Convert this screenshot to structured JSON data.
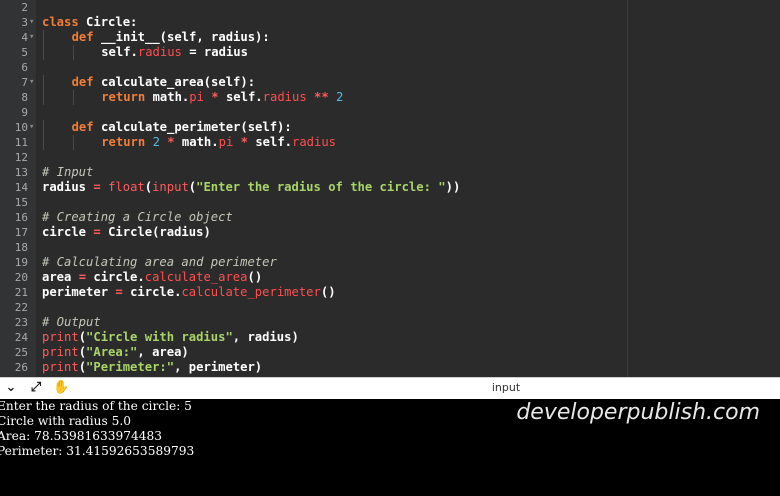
{
  "editor": {
    "lines": [
      {
        "n": "2",
        "fold": false,
        "indent": 0,
        "tokens": []
      },
      {
        "n": "3",
        "fold": true,
        "indent": 0,
        "tokens": [
          [
            "kw",
            "class "
          ],
          [
            "fn",
            "Circle:"
          ]
        ]
      },
      {
        "n": "4",
        "fold": true,
        "indent": 1,
        "tokens": [
          [
            "kw",
            "def "
          ],
          [
            "fn",
            "__init__(self, radius):"
          ]
        ]
      },
      {
        "n": "5",
        "fold": false,
        "indent": 2,
        "tokens": [
          [
            "fn",
            "self."
          ],
          [
            "attr",
            "radius"
          ],
          [
            "fn",
            " = radius"
          ]
        ]
      },
      {
        "n": "6",
        "fold": false,
        "indent": 0,
        "tokens": []
      },
      {
        "n": "7",
        "fold": true,
        "indent": 1,
        "tokens": [
          [
            "kw",
            "def "
          ],
          [
            "fn",
            "calculate_area(self):"
          ]
        ]
      },
      {
        "n": "8",
        "fold": false,
        "indent": 2,
        "tokens": [
          [
            "kw",
            "return "
          ],
          [
            "fn",
            "math."
          ],
          [
            "attr",
            "pi"
          ],
          [
            "op",
            " * "
          ],
          [
            "fn",
            "self."
          ],
          [
            "attr",
            "radius"
          ],
          [
            "op",
            " ** "
          ],
          [
            "num",
            "2"
          ]
        ]
      },
      {
        "n": "9",
        "fold": false,
        "indent": 0,
        "tokens": []
      },
      {
        "n": "10",
        "fold": true,
        "indent": 1,
        "tokens": [
          [
            "kw",
            "def "
          ],
          [
            "fn",
            "calculate_perimeter(self):"
          ]
        ]
      },
      {
        "n": "11",
        "fold": false,
        "indent": 2,
        "tokens": [
          [
            "kw",
            "return "
          ],
          [
            "num",
            "2"
          ],
          [
            "op",
            " * "
          ],
          [
            "fn",
            "math."
          ],
          [
            "attr",
            "pi"
          ],
          [
            "op",
            " * "
          ],
          [
            "fn",
            "self."
          ],
          [
            "attr",
            "radius"
          ]
        ]
      },
      {
        "n": "12",
        "fold": false,
        "indent": 0,
        "tokens": []
      },
      {
        "n": "13",
        "fold": false,
        "indent": 0,
        "tokens": [
          [
            "cmt",
            "# Input"
          ]
        ]
      },
      {
        "n": "14",
        "fold": false,
        "indent": 0,
        "tokens": [
          [
            "fn",
            "radius "
          ],
          [
            "op",
            "= "
          ],
          [
            "bi",
            "float"
          ],
          [
            "fn",
            "("
          ],
          [
            "bi",
            "input"
          ],
          [
            "fn",
            "("
          ],
          [
            "str",
            "\"Enter the radius of the circle: \""
          ],
          [
            "fn",
            "))"
          ]
        ]
      },
      {
        "n": "15",
        "fold": false,
        "indent": 0,
        "tokens": []
      },
      {
        "n": "16",
        "fold": false,
        "indent": 0,
        "tokens": [
          [
            "cmt",
            "# Creating a Circle object"
          ]
        ]
      },
      {
        "n": "17",
        "fold": false,
        "indent": 0,
        "tokens": [
          [
            "fn",
            "circle "
          ],
          [
            "op",
            "= "
          ],
          [
            "fn",
            "Circle(radius)"
          ]
        ]
      },
      {
        "n": "18",
        "fold": false,
        "indent": 0,
        "tokens": []
      },
      {
        "n": "19",
        "fold": false,
        "indent": 0,
        "tokens": [
          [
            "cmt",
            "# Calculating area and perimeter"
          ]
        ]
      },
      {
        "n": "20",
        "fold": false,
        "indent": 0,
        "tokens": [
          [
            "fn",
            "area "
          ],
          [
            "op",
            "= "
          ],
          [
            "fn",
            "circle."
          ],
          [
            "attr",
            "calculate_area"
          ],
          [
            "fn",
            "()"
          ]
        ]
      },
      {
        "n": "21",
        "fold": false,
        "indent": 0,
        "tokens": [
          [
            "fn",
            "perimeter "
          ],
          [
            "op",
            "= "
          ],
          [
            "fn",
            "circle."
          ],
          [
            "attr",
            "calculate_perimeter"
          ],
          [
            "fn",
            "()"
          ]
        ]
      },
      {
        "n": "22",
        "fold": false,
        "indent": 0,
        "tokens": []
      },
      {
        "n": "23",
        "fold": false,
        "indent": 0,
        "tokens": [
          [
            "cmt",
            "# Output"
          ]
        ]
      },
      {
        "n": "24",
        "fold": false,
        "indent": 0,
        "tokens": [
          [
            "bi",
            "print"
          ],
          [
            "fn",
            "("
          ],
          [
            "str",
            "\"Circle with radius\""
          ],
          [
            "fn",
            ", radius)"
          ]
        ]
      },
      {
        "n": "25",
        "fold": false,
        "indent": 0,
        "tokens": [
          [
            "bi",
            "print"
          ],
          [
            "fn",
            "("
          ],
          [
            "str",
            "\"Area:\""
          ],
          [
            "fn",
            ", area)"
          ]
        ]
      },
      {
        "n": "26",
        "fold": false,
        "indent": 0,
        "tokens": [
          [
            "bi",
            "print"
          ],
          [
            "fn",
            "("
          ],
          [
            "str",
            "\"Perimeter:\""
          ],
          [
            "fn",
            ", perimeter)"
          ]
        ]
      }
    ]
  },
  "toolbar": {
    "panel_title": "input",
    "icons": [
      "chevron-down-icon",
      "expand-icon",
      "pan-hand-icon"
    ]
  },
  "console": {
    "lines": [
      "Enter the radius of the circle: 5",
      "Circle with radius 5.0",
      "Area: 78.53981633974483",
      "Perimeter: 31.41592653589793"
    ]
  },
  "watermark": "developerpublish.com",
  "colors": {
    "editor_bg": "#2b2b2b",
    "keyword": "#f07e38",
    "string": "#a8d468",
    "number": "#54b7e6",
    "attribute": "#ff4f4f",
    "comment": "#c3c7b8",
    "console_bg": "#000000"
  }
}
